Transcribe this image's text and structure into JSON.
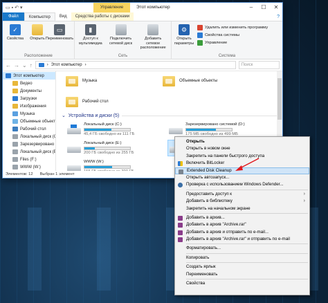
{
  "window": {
    "manage_tab": "Управление",
    "title": "Этот компьютер"
  },
  "tabs": {
    "file": "Файл",
    "computer": "Компьютер",
    "view": "Вид",
    "drive_tools": "Средства работы с дисками"
  },
  "ribbon": {
    "location": {
      "title": "Расположение",
      "buttons": [
        "Свойства",
        "Открыть",
        "Переименовать"
      ]
    },
    "network": {
      "title": "Сеть",
      "buttons": [
        "Доступ к мультимедиа",
        "Подключить сетевой диск",
        "Добавить сетевое расположение"
      ]
    },
    "system": {
      "title": "Система",
      "open_settings": "Открыть параметры",
      "small": [
        "Удалить или изменить программу",
        "Свойства системы",
        "Управление"
      ]
    }
  },
  "address": {
    "path": "Этот компьютер",
    "search_placeholder": "Поиск"
  },
  "nav": {
    "items": [
      {
        "label": "Этот компьютер",
        "icon": "pc-icon"
      },
      {
        "label": "Видео",
        "icon": "folder-icon"
      },
      {
        "label": "Документы",
        "icon": "folder-icon"
      },
      {
        "label": "Загрузки",
        "icon": "download-icon"
      },
      {
        "label": "Изображения",
        "icon": "folder-icon"
      },
      {
        "label": "Музыка",
        "icon": "music-icon"
      },
      {
        "label": "Объемные объекты",
        "icon": "objects-icon"
      },
      {
        "label": "Рабочий стол",
        "icon": "desktop-icon"
      },
      {
        "label": "Локальный диск (C:)",
        "icon": "drive-icon"
      },
      {
        "label": "Зарезервировано системой",
        "icon": "drive-icon"
      },
      {
        "label": "Локальный диск (E:)",
        "icon": "drive-icon"
      },
      {
        "label": "Files (F:)",
        "icon": "drive-icon"
      },
      {
        "label": "WWW (W:)",
        "icon": "drive-icon"
      }
    ]
  },
  "folders": [
    {
      "label": "Музыка"
    },
    {
      "label": "Объемные объекты"
    },
    {
      "label": "Рабочий стол"
    }
  ],
  "devices_section": "Устройства и диски (5)",
  "drives": [
    {
      "name": "Локальный диск (C:)",
      "free": "45,4 ГБ свободно из 111 ГБ",
      "used_fraction": 0.59,
      "selected": false
    },
    {
      "name": "Зарезервировано системой (D:)",
      "free": "175 МБ свободно из 499 МБ",
      "used_fraction": 0.65,
      "selected": false
    },
    {
      "name": "Локальный диск (E:)",
      "free": "200 ГБ свободно из 255 ГБ",
      "used_fraction": 0.22,
      "selected": false
    },
    {
      "name": "Files (F:)",
      "free": "",
      "used_fraction": 0.5,
      "selected": true
    },
    {
      "name": "WWW (W:)",
      "free": "155 ГБ свободно из 390 ГБ",
      "used_fraction": 0.6,
      "selected": false
    }
  ],
  "status": {
    "items": "Элементов: 12",
    "selected": "Выбран 1 элемент"
  },
  "context_menu": {
    "items": [
      {
        "label": "Открыть",
        "bold": true
      },
      {
        "label": "Открыть в новом окне"
      },
      {
        "label": "Закрепить на панели быстрого доступа"
      },
      {
        "label": "Включить BitLocker",
        "icon": "shield-icon"
      },
      {
        "label": "Extended Disk Cleanup",
        "icon": "disk-cleanup-icon",
        "highlight": true
      },
      {
        "label": "Открыть автозапуск..."
      },
      {
        "label": "Проверка с использованием Windows Defender...",
        "icon": "defender-icon"
      },
      {
        "sep": true
      },
      {
        "label": "Предоставить доступ к",
        "submenu": true
      },
      {
        "label": "Добавить в библиотеку",
        "submenu": true
      },
      {
        "label": "Закрепить на начальном экране"
      },
      {
        "sep": true
      },
      {
        "label": "Добавить в архив...",
        "icon": "rar-icon"
      },
      {
        "label": "Добавить в архив \"Archive.rar\"",
        "icon": "rar-icon"
      },
      {
        "label": "Добавить в архив и отправить по e-mail...",
        "icon": "rar-icon"
      },
      {
        "label": "Добавить в архив \"Archive.rar\" и отправить по e-mail",
        "icon": "rar-icon"
      },
      {
        "sep": true
      },
      {
        "label": "Форматировать..."
      },
      {
        "sep": true
      },
      {
        "label": "Копировать"
      },
      {
        "sep": true
      },
      {
        "label": "Создать ярлык"
      },
      {
        "label": "Переименовать"
      },
      {
        "sep": true
      },
      {
        "label": "Свойства"
      }
    ]
  },
  "colors": {
    "file_tab": "#1979ca",
    "manage_tab": "#f7d35e",
    "selection": "#cce8ff",
    "drive_bar": "#26a0da",
    "annotation_arrow": "#e0191e"
  }
}
